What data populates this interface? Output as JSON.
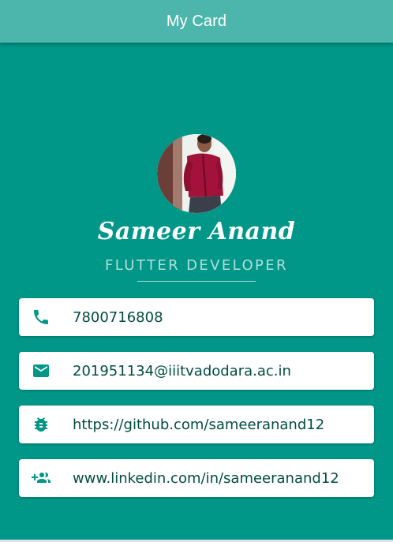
{
  "app": {
    "title": "My Card"
  },
  "profile": {
    "name": "Sameer Anand",
    "title": "FLUTTER DEVELOPER"
  },
  "contacts": [
    {
      "icon": "phone-icon",
      "text": "7800716808"
    },
    {
      "icon": "email-icon",
      "text": "201951134@iiitvadodara.ac.in"
    },
    {
      "icon": "bug-icon",
      "text": "https://github.com/sameeranand12"
    },
    {
      "icon": "group-add-icon",
      "text": "www.linkedin.com/in/sameeranand12"
    }
  ],
  "colors": {
    "background": "#009688",
    "appbar": "#4db6ac",
    "icon": "#009688",
    "text": "#004d40",
    "subtitle": "#b2dfdb"
  }
}
